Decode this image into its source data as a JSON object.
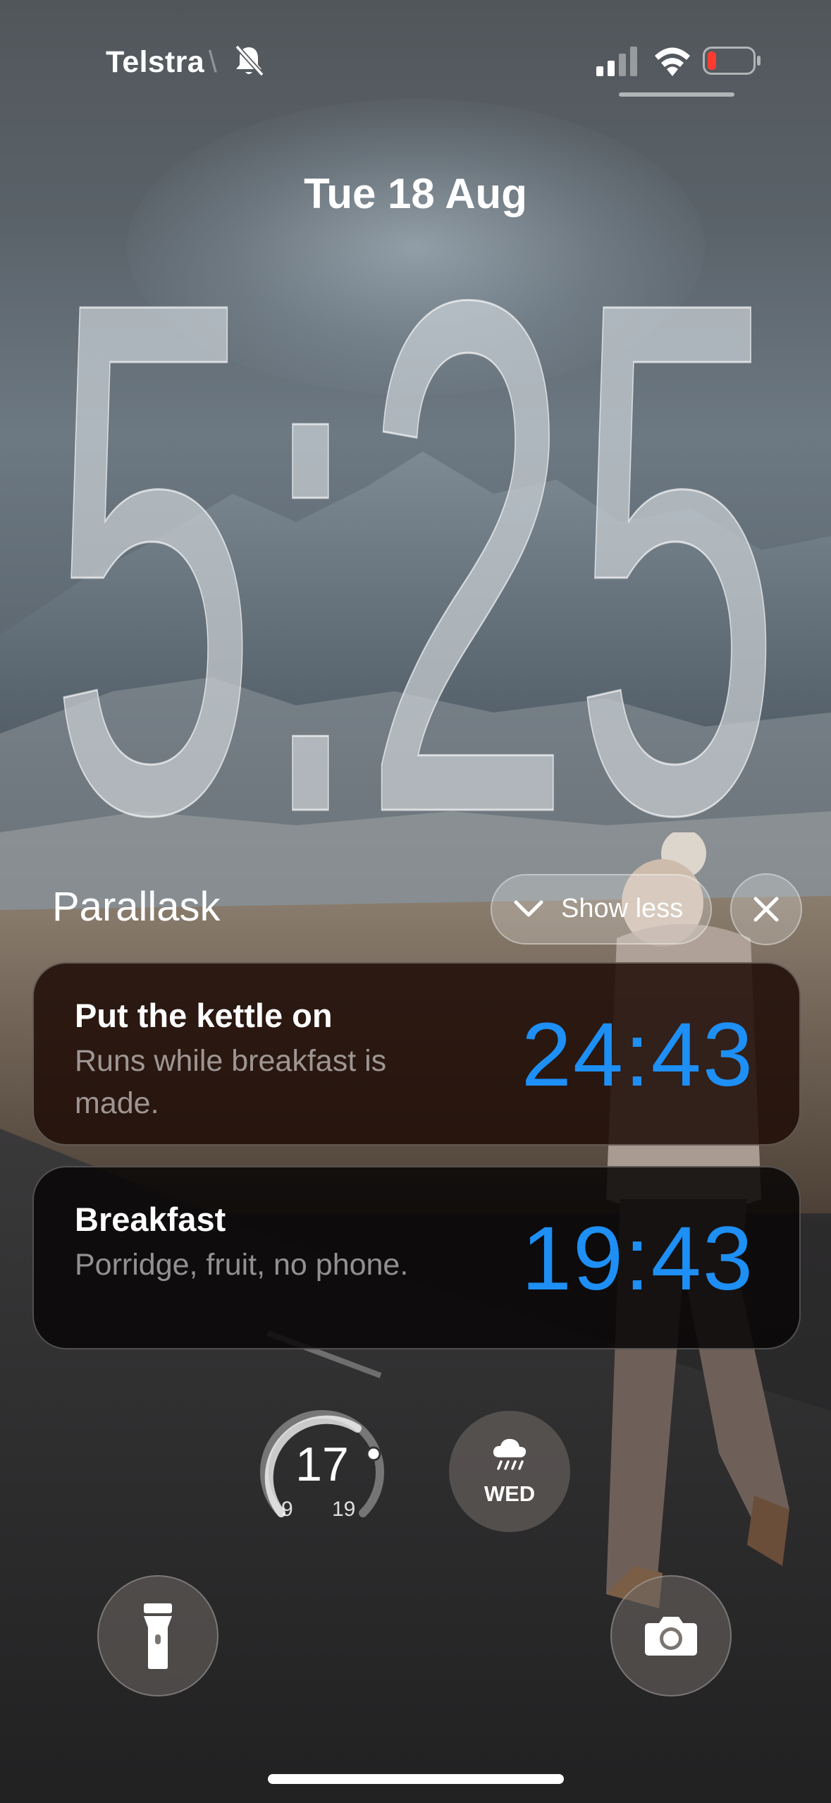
{
  "status_bar": {
    "carrier": "Telstra",
    "mute_icon": "bell-slash-icon",
    "signal_icon": "cellular-signal-icon",
    "wifi_icon": "wifi-icon",
    "battery_icon": "battery-low-icon"
  },
  "lock_screen": {
    "date": "Tue 18 Aug",
    "time": "5:25"
  },
  "widget_stack": {
    "title": "Parallask",
    "show_less_label": "Show less",
    "close_icon": "close-icon",
    "timers": [
      {
        "title": "Put the kettle on",
        "subtitle": "Runs while breakfast is made.",
        "remaining": "24:43"
      },
      {
        "title": "Breakfast",
        "subtitle": "Porridge, fruit, no phone.",
        "remaining": "19:43"
      }
    ]
  },
  "widgets": {
    "temperature": {
      "current": "17",
      "low": "9",
      "high": "19"
    },
    "weather": {
      "icon": "cloud-rain-icon",
      "day": "WED"
    }
  },
  "quick_actions": {
    "flashlight_icon": "flashlight-icon",
    "camera_icon": "camera-icon"
  },
  "colors": {
    "timer_accent": "#1d8ff5",
    "battery_low": "#ff3b30"
  }
}
